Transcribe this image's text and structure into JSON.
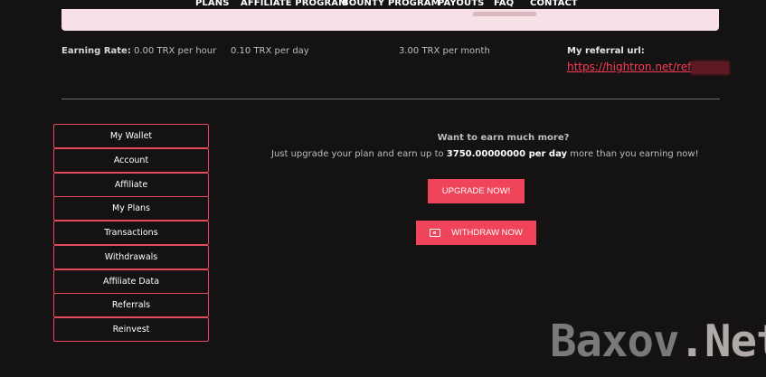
{
  "nav": {
    "items": [
      "PLANS",
      "AFFILIATE PROGRAM",
      "BOUNTY PROGRAM",
      "PAYOUTS",
      "FAQ",
      "CONTACT"
    ]
  },
  "earnings": {
    "label": "Earning Rate:",
    "hour": "0.00 TRX per hour",
    "day": "0.10 TRX per day",
    "month": "3.00 TRX per month"
  },
  "referral": {
    "label": "My referral url:",
    "url": "https://hightron.net/ref/"
  },
  "sidebar": {
    "items": [
      "My Wallet",
      "Account",
      "Affiliate",
      "My Plans",
      "Transactions",
      "Withdrawals",
      "Affiliate Data",
      "Referrals",
      "Reinvest"
    ]
  },
  "upsell": {
    "title": "Want to earn much more?",
    "text_before": "Just upgrade your plan and earn up to ",
    "amount": "3750.00000000 per day",
    "text_after": " more than you earning now!"
  },
  "buttons": {
    "upgrade": "UPGRADE NOW!",
    "withdraw": "WITHDRAW NOW",
    "withdraw_icon": "money-icon"
  },
  "watermark": {
    "part1": "Baxov",
    "part2": ".Net"
  },
  "colors": {
    "background": "#141212",
    "accent": "#ef4459",
    "link": "#ff3b55",
    "alert": "#f7e1e6"
  }
}
